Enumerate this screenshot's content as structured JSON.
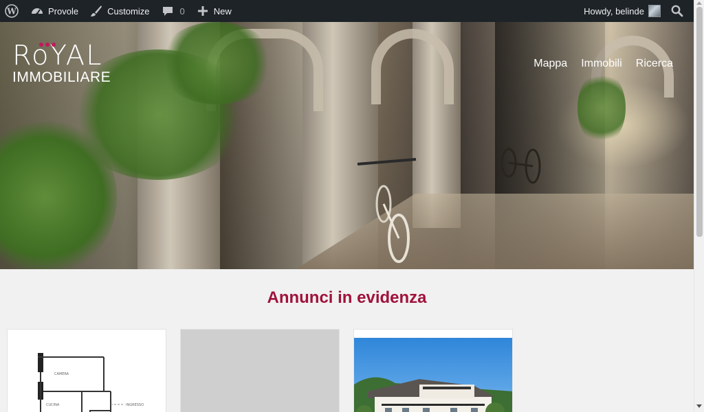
{
  "admin_bar": {
    "site_name": "Provole",
    "customize": "Customize",
    "comments_count": "0",
    "new": "New",
    "howdy": "Howdy, belinde"
  },
  "header": {
    "logo_main": "RoYAL",
    "logo_sub": "IMMOBILIARE",
    "nav": [
      "Mappa",
      "Immobili",
      "Ricerca"
    ]
  },
  "main": {
    "featured_title": "Annunci in evidenza",
    "plan_labels": [
      "CAMERA",
      "CUCINA",
      "INGRESSO"
    ]
  },
  "colors": {
    "admin_bg": "#1d2327",
    "accent": "#a0123b",
    "logo_dots": "#c2185b"
  }
}
